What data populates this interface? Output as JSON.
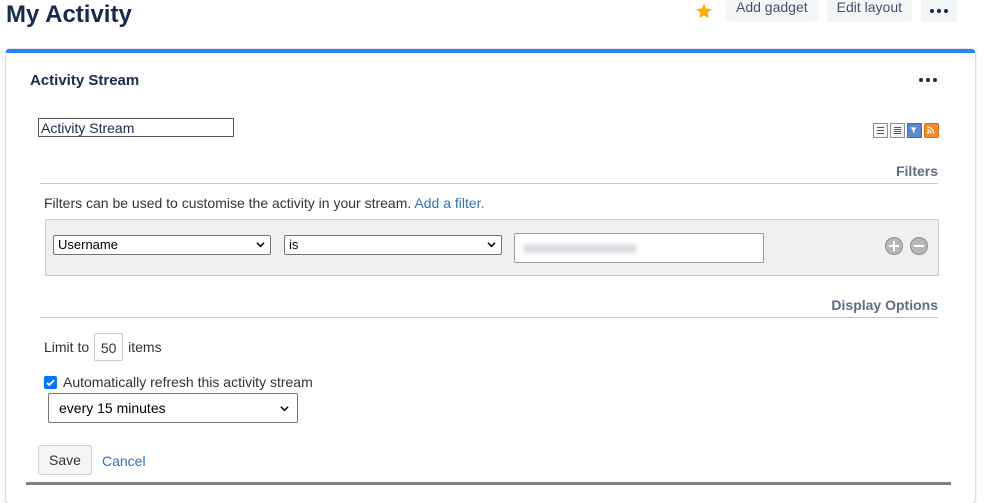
{
  "page": {
    "title": "My Activity"
  },
  "toolbar": {
    "star_icon": "star-icon",
    "star_color": "#ffab00",
    "add_gadget": "Add gadget",
    "edit_layout": "Edit layout",
    "more_icon": "more-horizontal-icon"
  },
  "gadget": {
    "title": "Activity Stream",
    "accent_color": "#2684ff",
    "menu_icon": "more-horizontal-icon",
    "title_input_value": "Activity Stream",
    "view_icons": [
      "full-view-icon",
      "list-view-icon",
      "filter-view-icon",
      "rss-feed-icon"
    ]
  },
  "filters": {
    "heading": "Filters",
    "description": "Filters can be used to customise the activity in your stream.",
    "add_filter_link": "Add a filter.",
    "field_select": "Username",
    "operator_select": "is",
    "value_blurred": true,
    "add_icon": "plus-circle-icon",
    "remove_icon": "minus-circle-icon"
  },
  "display_options": {
    "heading": "Display Options",
    "limit_prefix": "Limit to",
    "limit_value": "50",
    "limit_suffix": "items",
    "auto_refresh_checked": true,
    "auto_refresh_label": "Automatically refresh this activity stream",
    "refresh_interval": "every 15 minutes"
  },
  "actions": {
    "save": "Save",
    "cancel": "Cancel"
  }
}
